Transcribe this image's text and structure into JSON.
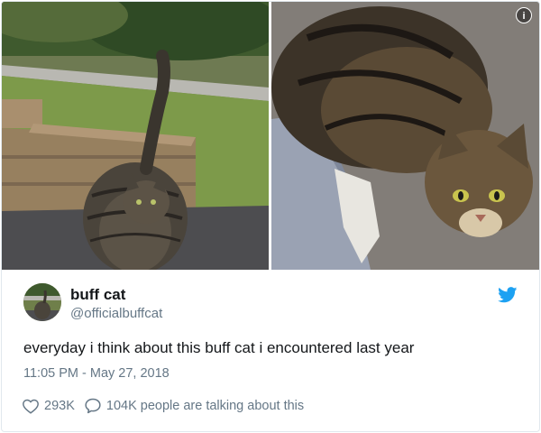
{
  "media": {
    "info_icon": "info-icon",
    "info_label": "i"
  },
  "tweet": {
    "display_name": "buff cat",
    "handle": "@officialbuffcat",
    "text": "everyday i think about this buff cat i encountered last year",
    "timestamp": "11:05 PM - May 27, 2018",
    "likes": "293K",
    "replies_text": "104K people are talking about this",
    "brand_color": "#1da1f2",
    "icons": [
      "heart-icon",
      "speech-bubble-icon",
      "twitter-bird-icon"
    ]
  }
}
